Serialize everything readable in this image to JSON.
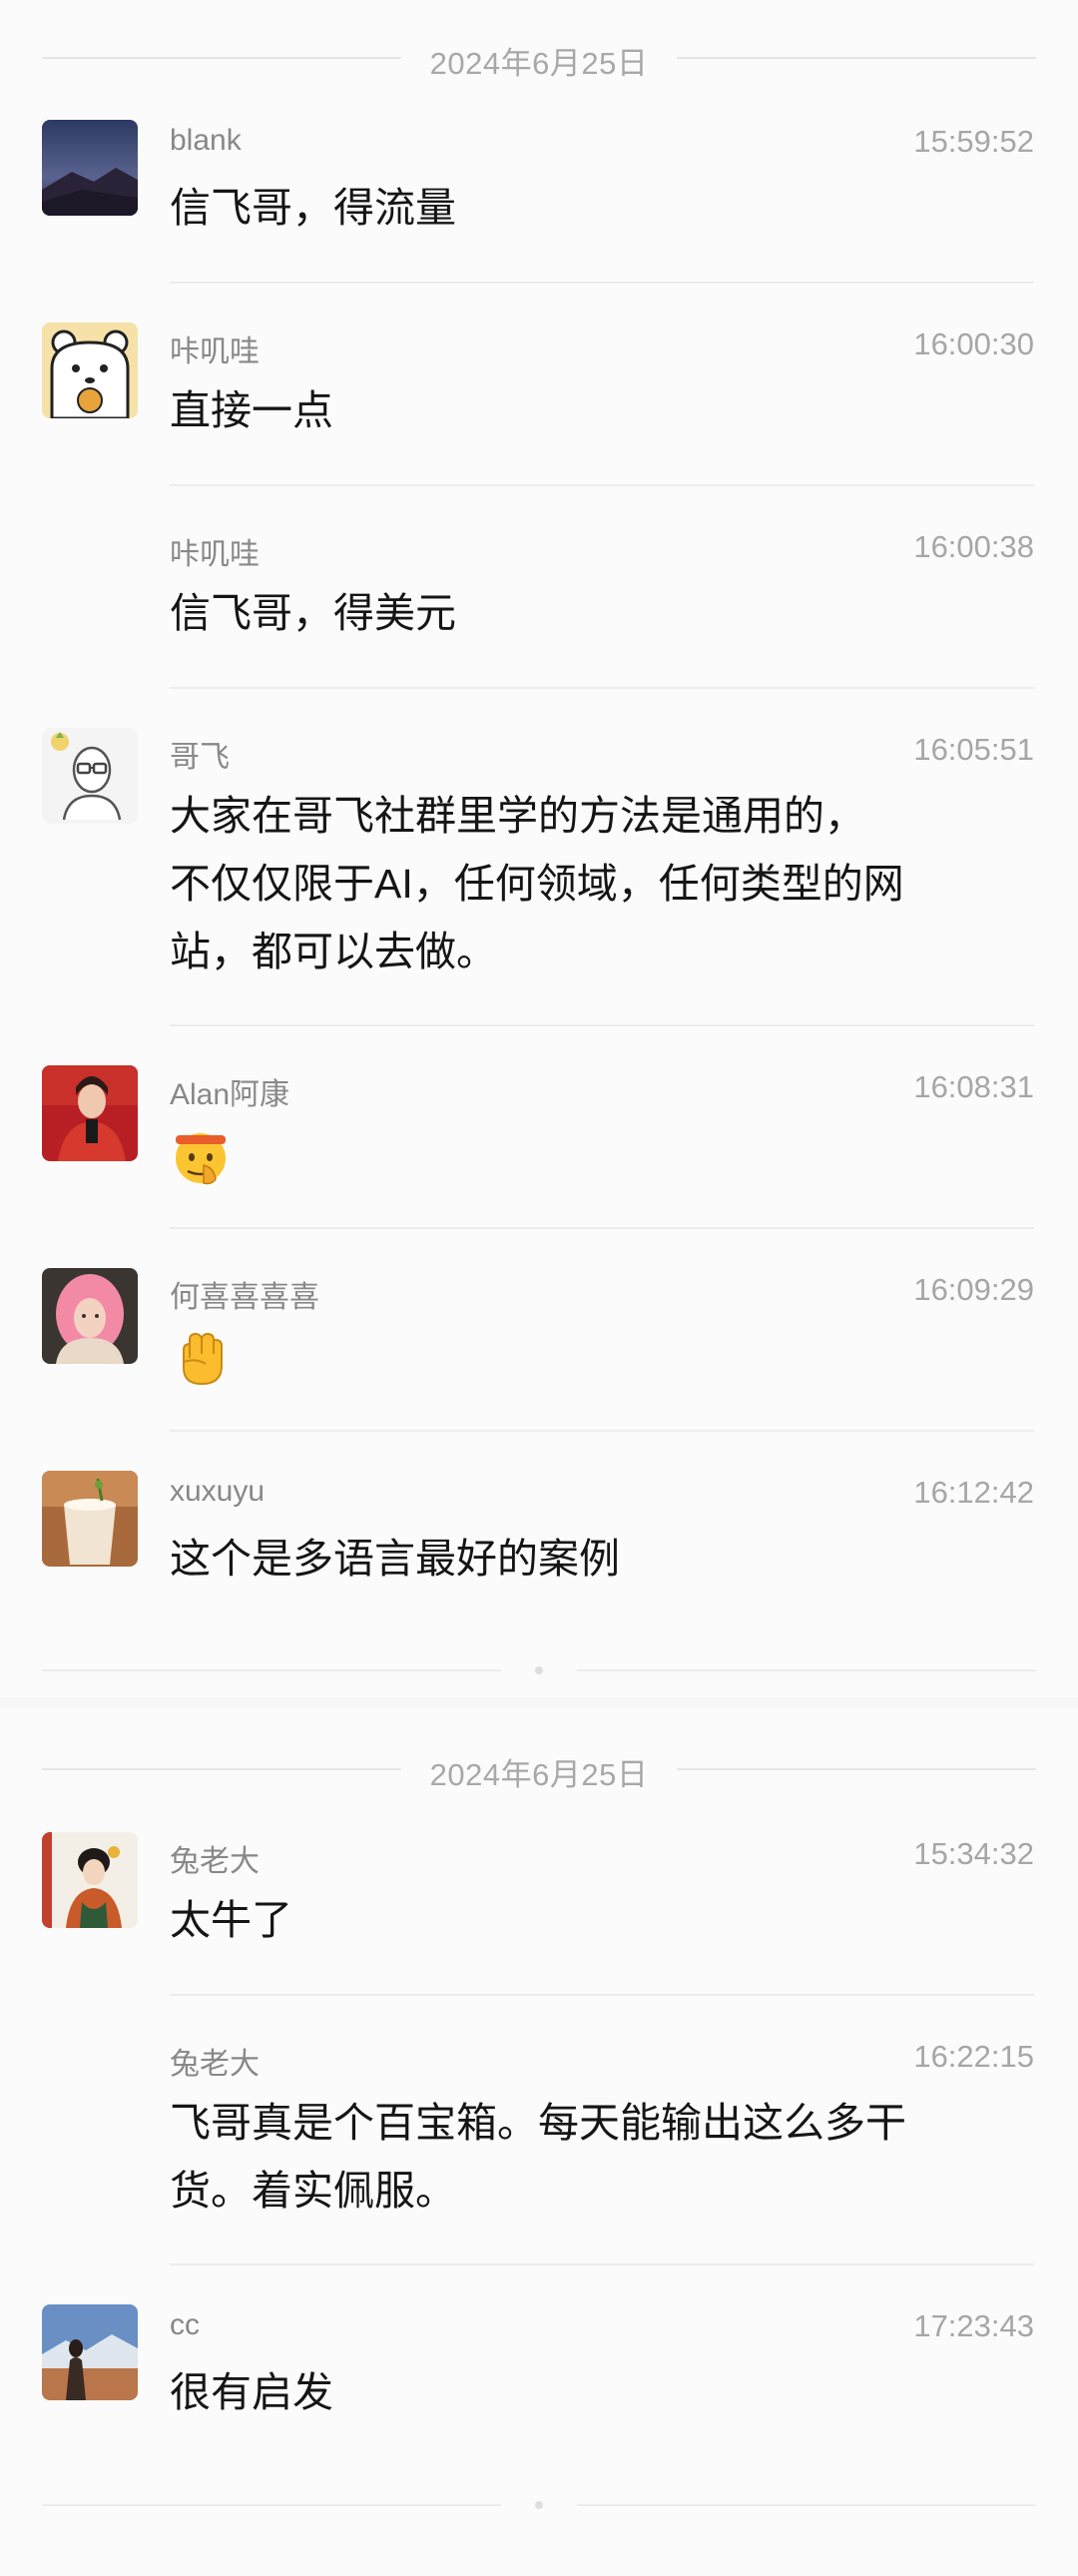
{
  "sections": [
    {
      "date": "2024年6月25日",
      "messages": [
        {
          "sender": "blank",
          "time": "15:59:52",
          "text": "信飞哥，得流量",
          "avatar": "night-sky-avatar"
        },
        {
          "sender": "咔叽哇",
          "time": "16:00:30",
          "text": "直接一点",
          "avatar": "bear-avatar"
        },
        {
          "sender": "咔叽哇",
          "time": "16:00:38",
          "text": "信飞哥，得美元"
        },
        {
          "sender": "哥飞",
          "time": "16:05:51",
          "text_lines": [
            "大家在哥飞社群里学的方法是通用的，",
            "不仅仅限于AI，任何领域，任何类型的网",
            "站，都可以去做。"
          ],
          "avatar": "glasses-man-avatar"
        },
        {
          "sender": "Alan阿康",
          "time": "16:08:31",
          "emoji": "shushing-face-emoji",
          "avatar": "red-portrait-avatar"
        },
        {
          "sender": "何喜喜喜喜",
          "time": "16:09:29",
          "emoji": "raised-fist-emoji",
          "avatar": "pink-hair-avatar"
        },
        {
          "sender": "xuxuyu",
          "time": "16:12:42",
          "text": "这个是多语言最好的案例",
          "avatar": "drink-avatar"
        }
      ]
    },
    {
      "date": "2024年6月25日",
      "messages": [
        {
          "sender": "兔老大",
          "time": "15:34:32",
          "text": "太牛了",
          "avatar": "illustrated-girl-avatar"
        },
        {
          "sender": "兔老大",
          "time": "16:22:15",
          "text_lines": [
            "飞哥真是个百宝箱。每天能输出这么多干",
            "货。着实佩服。"
          ]
        },
        {
          "sender": "cc",
          "time": "17:23:43",
          "text": "很有启发",
          "avatar": "landscape-avatar"
        }
      ]
    }
  ]
}
